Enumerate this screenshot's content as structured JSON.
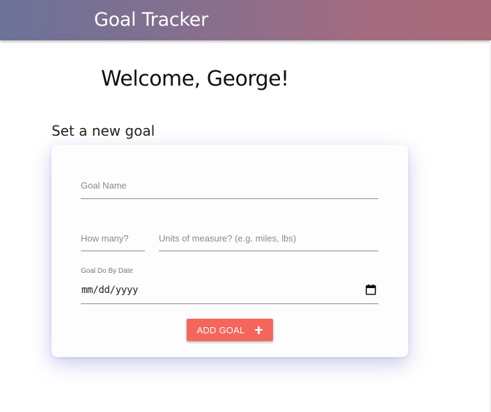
{
  "appbar": {
    "title": "Goal Tracker",
    "gradient_colors": [
      "#6b7298",
      "#a86a79"
    ]
  },
  "main": {
    "welcome": "Welcome, George!",
    "section_title": "Set a new goal"
  },
  "form": {
    "goal_name": {
      "placeholder": "Goal Name",
      "value": ""
    },
    "quantity": {
      "placeholder": "How many?",
      "value": ""
    },
    "units": {
      "placeholder": "Units of measure? (e.g. miles, lbs)",
      "value": ""
    },
    "due_date": {
      "label": "Goal Do By Date",
      "value": "mm/dd/yyyy",
      "icon": "calendar-icon"
    },
    "submit": {
      "label": "ADD GOAL",
      "icon": "plus-icon",
      "color": "#f4655b"
    }
  }
}
